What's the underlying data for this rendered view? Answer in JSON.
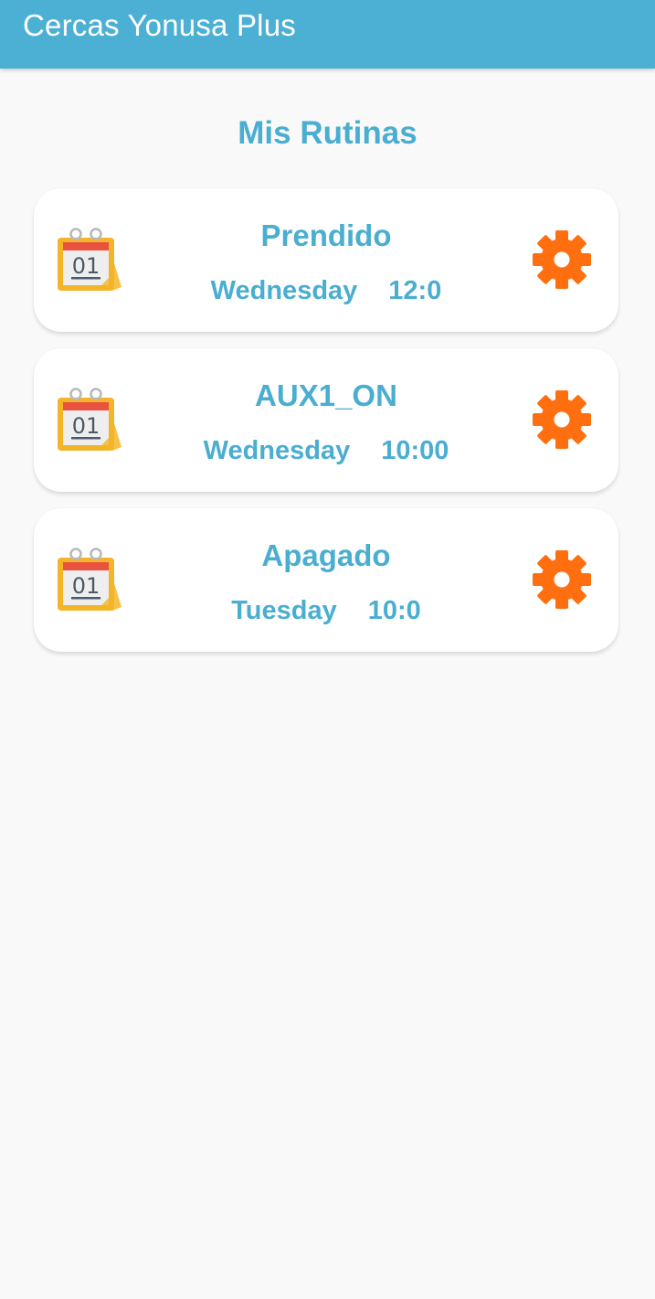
{
  "app_bar": {
    "title": "Cercas Yonusa Plus",
    "color": "#4bb0d4"
  },
  "page": {
    "title": "Mis Rutinas"
  },
  "routines": [
    {
      "name": "Prendido",
      "day": "Wednesday",
      "time": "12:0",
      "icon": "calendar-icon",
      "action_icon": "gear-icon"
    },
    {
      "name": "AUX1_ON",
      "day": "Wednesday",
      "time": "10:00",
      "icon": "calendar-icon",
      "action_icon": "gear-icon"
    },
    {
      "name": "Apagado",
      "day": "Tuesday",
      "time": "10:0",
      "icon": "calendar-icon",
      "action_icon": "gear-icon"
    }
  ],
  "calendar_icon": {
    "date_text": "01"
  },
  "colors": {
    "accent_text": "#4aaed1",
    "gear": "#ff6f0f",
    "background": "#f9f9fa"
  }
}
